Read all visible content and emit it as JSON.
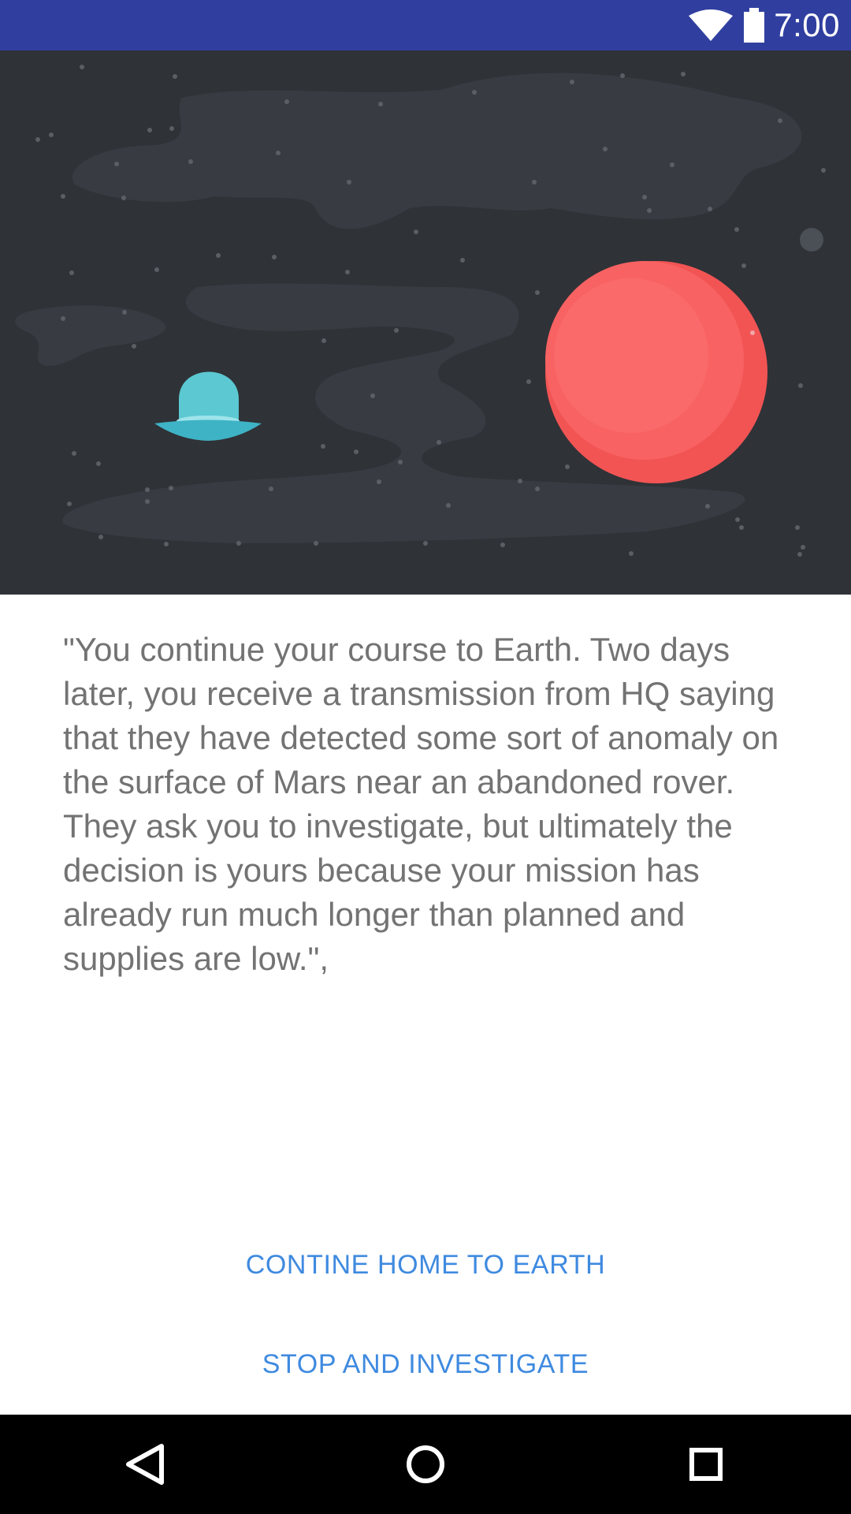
{
  "status_bar": {
    "time": "7:00",
    "icons": [
      "wifi-icon",
      "battery-icon"
    ],
    "background_color": "#303f9f"
  },
  "hero": {
    "description_icons": [
      "flying-saucer-icon",
      "red-planet-icon",
      "small-moon-icon"
    ],
    "colors": {
      "sky": "#2f3237",
      "nebula": "#383c42",
      "saucer": "#5bc8d2",
      "planet": "#f25454"
    }
  },
  "story": {
    "text": "\"You continue your course to Earth. Two days later, you receive a transmission from HQ saying that they have detected some sort of anomaly on the surface of Mars near an abandoned rover. They ask you to investigate, but ultimately the decision is yours because your mission has already run much longer than planned and supplies are low.\","
  },
  "actions": {
    "continue_label": "CONTINE HOME TO EARTH",
    "investigate_label": "STOP AND INVESTIGATE",
    "accent_color": "#3f8ae0"
  },
  "nav_bar": {
    "icons": [
      "back-icon",
      "home-icon",
      "recents-icon"
    ]
  }
}
